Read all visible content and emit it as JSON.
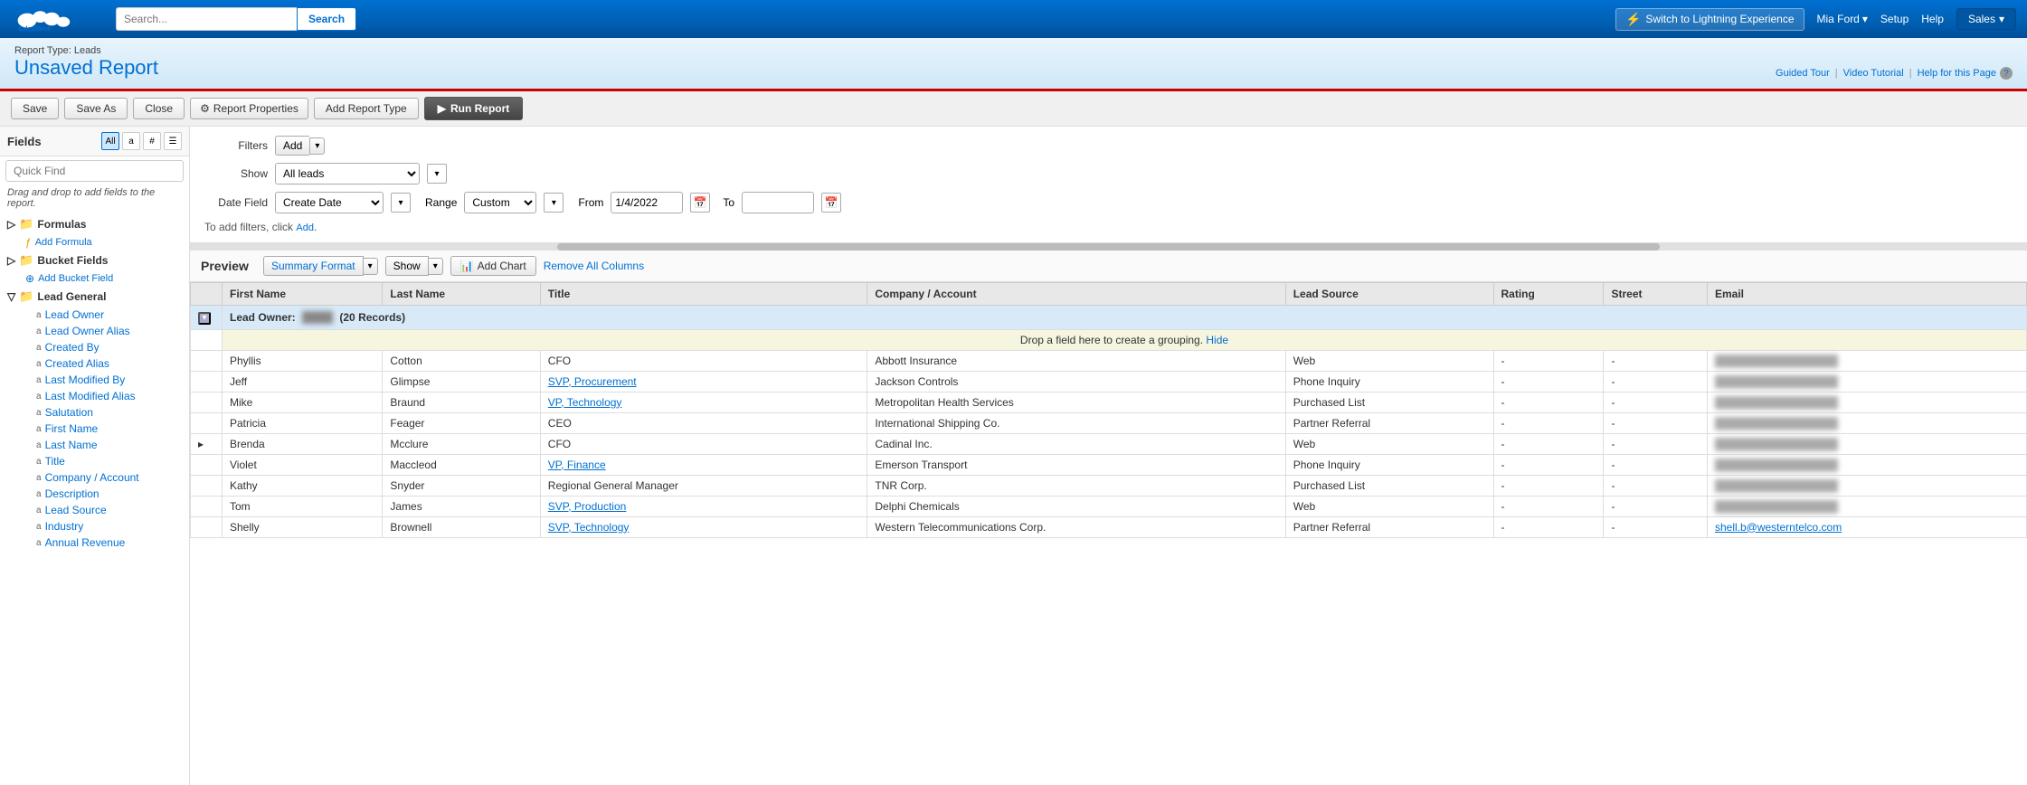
{
  "topnav": {
    "search_placeholder": "Search...",
    "search_button": "Search",
    "lightning_label": "Switch to Lightning Experience",
    "user_name": "Mia Ford",
    "setup_label": "Setup",
    "help_label": "Help",
    "sales_label": "Sales"
  },
  "report_header": {
    "type_label": "Report Type: Leads",
    "title": "Unsaved Report",
    "guided_tour": "Guided Tour",
    "video_tutorial": "Video Tutorial",
    "help_page": "Help for this Page"
  },
  "toolbar": {
    "save": "Save",
    "save_as": "Save As",
    "close": "Close",
    "report_properties": "Report Properties",
    "add_report_type": "Add Report Type",
    "run_report": "Run Report"
  },
  "fields_panel": {
    "title": "Fields",
    "filter_all": "All",
    "filter_alpha": "a",
    "filter_hash": "#",
    "filter_grid": "⊞",
    "quick_find_placeholder": "Quick Find",
    "drag_hint": "Drag and drop to add fields to the report.",
    "tree": {
      "formulas_label": "Formulas",
      "add_formula": "Add Formula",
      "bucket_fields_label": "Bucket Fields",
      "add_bucket": "Add Bucket Field",
      "lead_general_label": "Lead General",
      "fields": [
        "Lead Owner",
        "Lead Owner Alias",
        "Created By",
        "Created Alias",
        "Last Modified By",
        "Last Modified Alias",
        "Salutation",
        "First Name",
        "Last Name",
        "Title",
        "Company / Account",
        "Description",
        "Lead Source",
        "Industry",
        "Annual Revenue"
      ]
    }
  },
  "filters": {
    "add_label": "Add",
    "show_label": "Show",
    "show_value": "All leads",
    "date_field_label": "Date Field",
    "date_field_value": "Create Date",
    "range_label": "Range",
    "range_value": "Custom",
    "from_label": "From",
    "from_value": "1/4/2022",
    "to_label": "To",
    "to_value": "",
    "hint": "To add filters, click Add."
  },
  "preview": {
    "label": "Preview",
    "summary_format": "Summary Format",
    "show": "Show",
    "add_chart": "Add Chart",
    "remove_columns": "Remove All Columns",
    "columns": [
      "First Name",
      "Last Name",
      "Title",
      "Company / Account",
      "Lead Source",
      "Rating",
      "Street",
      "Email"
    ],
    "group_row": {
      "label": "Lead Owner:",
      "record_count": "(20 Records)"
    },
    "drop_zone": "Drop a field here to create a grouping.",
    "drop_hide": "Hide",
    "rows": [
      {
        "first": "Phyllis",
        "last": "Cotton",
        "title": "CFO",
        "company": "Abbott Insurance",
        "lead_source": "Web",
        "rating": "-",
        "street": "-",
        "email": "████████████████"
      },
      {
        "first": "Jeff",
        "last": "Glimpse",
        "title": "SVP, Procurement",
        "company": "Jackson Controls",
        "lead_source": "Phone Inquiry",
        "rating": "-",
        "street": "-",
        "email": "████████████████"
      },
      {
        "first": "Mike",
        "last": "Braund",
        "title": "VP, Technology",
        "company": "Metropolitan Health Services",
        "lead_source": "Purchased List",
        "rating": "-",
        "street": "-",
        "email": "████████████████"
      },
      {
        "first": "Patricia",
        "last": "Feager",
        "title": "CEO",
        "company": "International Shipping Co.",
        "lead_source": "Partner Referral",
        "rating": "-",
        "street": "-",
        "email": "████████████████"
      },
      {
        "first": "Brenda",
        "last": "Mcclure",
        "title": "CFO",
        "company": "Cadinal Inc.",
        "lead_source": "Web",
        "rating": "-",
        "street": "-",
        "email": "████████████████"
      },
      {
        "first": "Violet",
        "last": "Maccleod",
        "title": "VP, Finance",
        "company": "Emerson Transport",
        "lead_source": "Phone Inquiry",
        "rating": "-",
        "street": "-",
        "email": "████████████████"
      },
      {
        "first": "Kathy",
        "last": "Snyder",
        "title": "Regional General Manager",
        "company": "TNR Corp.",
        "lead_source": "Purchased List",
        "rating": "-",
        "street": "-",
        "email": "████████████████"
      },
      {
        "first": "Tom",
        "last": "James",
        "title": "SVP, Production",
        "company": "Delphi Chemicals",
        "lead_source": "Web",
        "rating": "-",
        "street": "-",
        "email": "████████████████"
      },
      {
        "first": "Shelly",
        "last": "Brownell",
        "title": "SVP, Technology",
        "company": "Western Telecommunications Corp.",
        "lead_source": "Partner Referral",
        "rating": "-",
        "street": "-",
        "email": "shell.b@westerntelco.com"
      }
    ]
  }
}
